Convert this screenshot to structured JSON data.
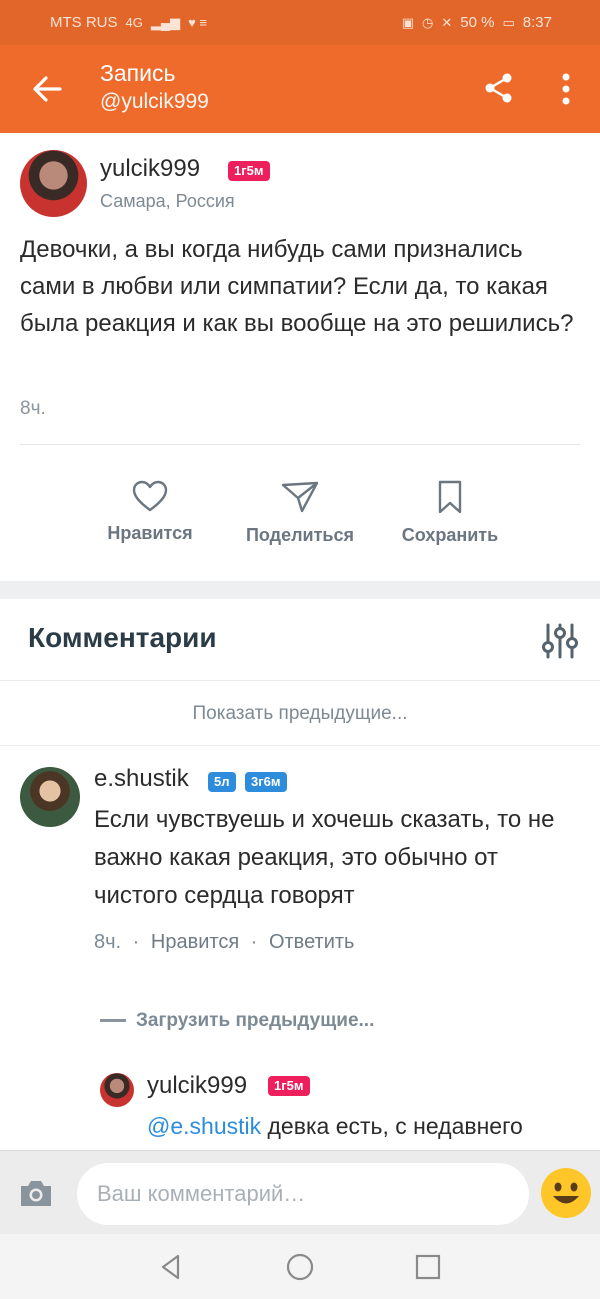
{
  "status_bar": {
    "carrier": "MTS RUS",
    "network": "4G",
    "battery": "50 %",
    "time": "8:37"
  },
  "app_bar": {
    "title": "Запись",
    "subtitle": "@yulcik999",
    "icons": [
      "back-arrow-icon",
      "share-icon",
      "more-vert-icon"
    ]
  },
  "post": {
    "author": "yulcik999",
    "author_badge": "1г5м",
    "location": "Самара, Россия",
    "text": "Девочки, а вы когда нибудь сами признались сами в любви или симпатии? Если да, то какая была реакция и как вы вообще на это решились?",
    "time": "8ч.",
    "actions": {
      "like": "Нравится",
      "share": "Поделиться",
      "save": "Сохранить"
    }
  },
  "comments": {
    "heading": "Комментарии",
    "show_previous": "Показать предыдущие...",
    "load_previous": "Загрузить предыдущие...",
    "items": [
      {
        "author": "e.shustik",
        "badges": [
          "5л",
          "3г6м"
        ],
        "text": "Если чувствуешь и хочешь сказать, то не важно какая реакция, это обычно от чистого сердца говорят",
        "time": "8ч.",
        "like": "Нравится",
        "reply": "Ответить"
      },
      {
        "author": "yulcik999",
        "badges": [
          "1г5м"
        ],
        "mention": "@e.shustik",
        "text": " девка есть, с недавнего"
      }
    ]
  },
  "compose": {
    "placeholder": "Ваш комментарий…"
  },
  "colors": {
    "app_bar": "#ef6b2c",
    "status_bar": "#e2662a",
    "badge_pink": "#ee1f5d",
    "badge_blue": "#2d8cdc",
    "link": "#2d8cdc"
  }
}
